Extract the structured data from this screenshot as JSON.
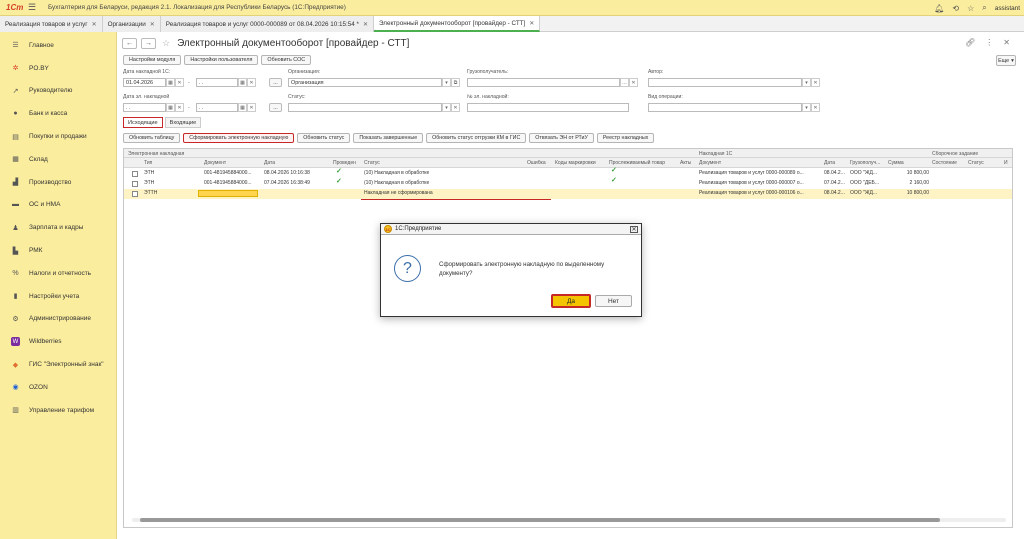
{
  "app": {
    "logo": "1Cm",
    "title": "Бухгалтерия для Беларуси, редакция 2.1. Локализация для Республики Беларусь   (1С:Предприятие)",
    "user": "assistant"
  },
  "open_tabs": [
    {
      "label": "Реализация товаров и услуг",
      "active": false
    },
    {
      "label": "Организации",
      "active": false
    },
    {
      "label": "Реализация товаров и услуг 0000-000089 от 08.04.2026 10:15:54 *",
      "active": false
    },
    {
      "label": "Электронный документооборот [провайдер - СТТ]",
      "active": true
    }
  ],
  "sidebar": {
    "items": [
      {
        "label": "Главное",
        "icon": "menu-icon",
        "glyph": "☰"
      },
      {
        "label": "PO.BY",
        "icon": "asterisk-icon",
        "glyph": "✲"
      },
      {
        "label": "Руководителю",
        "icon": "trend-icon",
        "glyph": "↗"
      },
      {
        "label": "Банк и касса",
        "icon": "coin-icon",
        "glyph": "●"
      },
      {
        "label": "Покупки и продажи",
        "icon": "cart-icon",
        "glyph": "▤"
      },
      {
        "label": "Склад",
        "icon": "warehouse-icon",
        "glyph": "▦"
      },
      {
        "label": "Производство",
        "icon": "factory-icon",
        "glyph": "▟"
      },
      {
        "label": "ОС и НМА",
        "icon": "truck-icon",
        "glyph": "▬"
      },
      {
        "label": "Зарплата и кадры",
        "icon": "person-icon",
        "glyph": "♟"
      },
      {
        "label": "РМК",
        "icon": "register-icon",
        "glyph": "▙"
      },
      {
        "label": "Налоги и отчетность",
        "icon": "percent-icon",
        "glyph": "%"
      },
      {
        "label": "Настройки учета",
        "icon": "book-icon",
        "glyph": "▮"
      },
      {
        "label": "Администрирование",
        "icon": "gear-icon",
        "glyph": "⚙"
      },
      {
        "label": "Wildberries",
        "icon": "wildberries-icon",
        "glyph": "W"
      },
      {
        "label": "ГИС \"Электронный знак\"",
        "icon": "diamond-icon",
        "glyph": "◆"
      },
      {
        "label": "OZON",
        "icon": "ozon-icon",
        "glyph": "◉"
      },
      {
        "label": "Управление тарифом",
        "icon": "tariff-icon",
        "glyph": "▥"
      }
    ]
  },
  "form": {
    "title": "Электронный документооборот [провайдер - СТТ]",
    "buttons": {
      "module_settings": "Настройки модуля",
      "user_settings": "Настройки пользователя",
      "update_sos": "Обновить СОС",
      "more": "Еще"
    },
    "filters": {
      "date_1c_label": "Дата накладной 1С:",
      "date_1c_from": "01.04.2026",
      "date_1c_to": ". .",
      "dash": "-",
      "ellipsis": "...",
      "org_label": "Организация:",
      "org_value": "Организация",
      "consignee_label": "Грузополучатель:",
      "author_label": "Автор:",
      "date_el_label": "Дата эл. накладной",
      "date_el_from": ". .",
      "date_el_to": ". .",
      "status_label": "Статус:",
      "el_num_label": "№ эл. накладной:",
      "op_type_label": "Вид операции:"
    },
    "doc_tabs": {
      "outgoing": "Исходящие",
      "incoming": "Входящие"
    },
    "action_buttons": [
      {
        "label": "Обновить таблицу",
        "highlighted": false
      },
      {
        "label": "Сформировать электронную накладную",
        "highlighted": true
      },
      {
        "label": "Обновить статус",
        "highlighted": false
      },
      {
        "label": "Показать завершенные",
        "highlighted": false
      },
      {
        "label": "Обновить статус отгрузки КМ в ГИС",
        "highlighted": false
      },
      {
        "label": "Отвязать ЭН от РТиУ",
        "highlighted": false
      },
      {
        "label": "Реестр накладных",
        "highlighted": false
      }
    ]
  },
  "table": {
    "groups": {
      "el": "Электронная накладная",
      "n1c": "Накладная 1С",
      "assembly": "Сборочное задание"
    },
    "columns": {
      "type": "Тип",
      "document": "Документ",
      "date": "Дата",
      "posted": "Проведен",
      "status": "Статус",
      "error": "Ошибка",
      "codes": "Коды маркировки",
      "tracked": "Прослеживаемый товар",
      "acts": "Акты",
      "doc1c": "Документ",
      "date1c": "Дата",
      "consignee": "Грузополуч...",
      "sum": "Сумма",
      "state": "Состояние",
      "status2": "Статус",
      "more": "И"
    },
    "rows": [
      {
        "type": "ЭТН",
        "document": "001-481945884000...",
        "date": "08.04.2026 10:16:38",
        "posted": "✓",
        "status": "(10) Накладная в обработке",
        "tracked": "✓",
        "doc1c": "Реализация товаров и услуг 0000-000089 о...",
        "date1c": "08.04.2...",
        "consignee": "ООО \"ЖД...",
        "sum": "10 800,00",
        "selected": false
      },
      {
        "type": "ЭТН",
        "document": "001-481945884000...",
        "date": "07.04.2026 16:38:49",
        "posted": "✓",
        "status": "(10) Накладная в обработке",
        "tracked": "✓",
        "doc1c": "Реализация товаров и услуг 0000-000007 о...",
        "date1c": "07.04.2...",
        "consignee": "ООО \"ДЕБ...",
        "sum": "2 160,00",
        "selected": false
      },
      {
        "type": "ЭТТН",
        "document": "",
        "date": "",
        "posted": "",
        "status": "Накладная не сформирована",
        "tracked": "",
        "doc1c": "Реализация товаров и услуг 0000-000106 о...",
        "date1c": "08.04.2...",
        "consignee": "ООО \"ЖД...",
        "sum": "10 800,00",
        "selected": true
      }
    ]
  },
  "dialog": {
    "title": "1С:Предприятие",
    "message": "Сформировать электронную накладную по выделенному документу?",
    "yes": "Да",
    "no": "Нет"
  }
}
